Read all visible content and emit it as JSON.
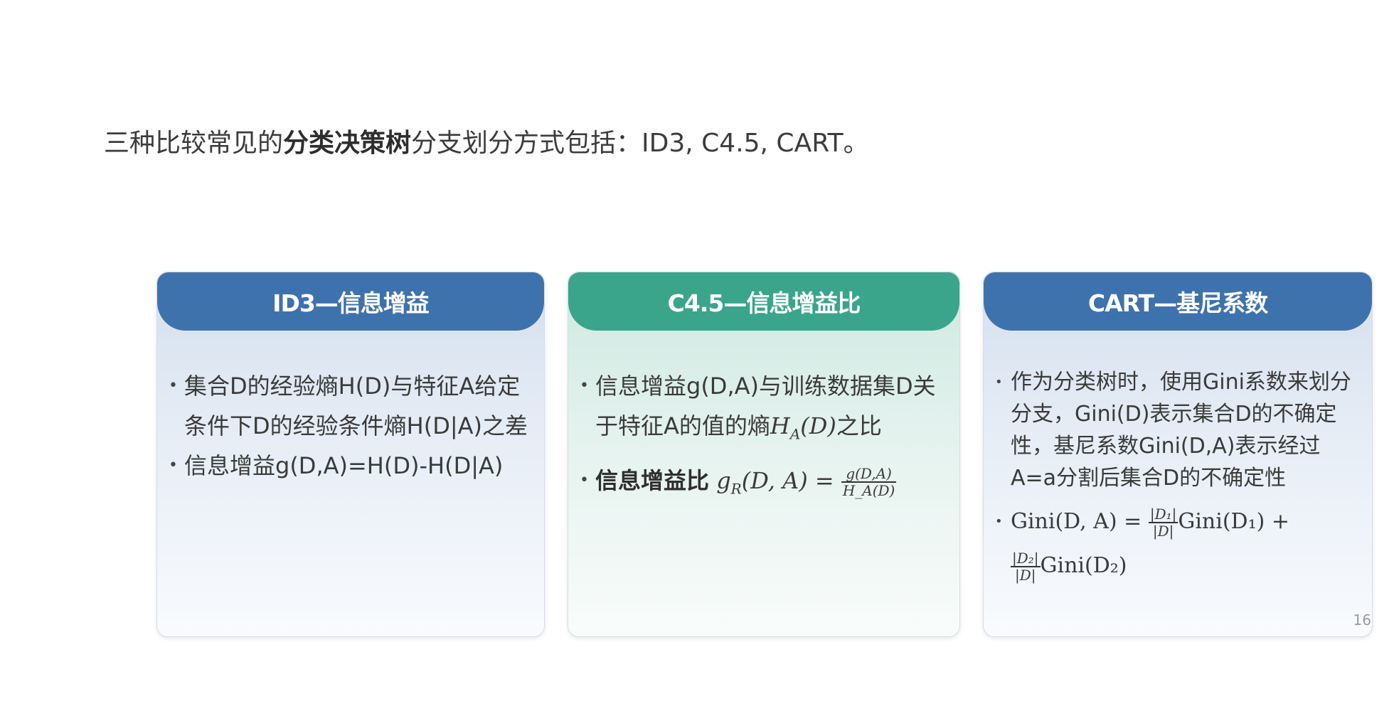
{
  "intro": {
    "prefix": "三种比较常见的",
    "bold": "分类决策树",
    "suffix": "分支划分方式包括：ID3, C4.5, CART。"
  },
  "cards": [
    {
      "title": "ID3—信息增益",
      "bullets": [
        "集合D的经验熵H(D)与特征A给定条件下D的经验条件熵H(D|A)之差",
        "信息增益g(D,A)=H(D)-H(D|A)"
      ]
    },
    {
      "title": "C4.5—信息增益比",
      "bullet1_text": "信息增益g(D,A)与训练数据集D关于特征A的值的熵",
      "bullet1_math": "H",
      "bullet1_math_sub": "A",
      "bullet1_math_tail": "(D)",
      "bullet1_end": "之比",
      "bullet2_label": "信息增益比",
      "bullet2_lhs": "g",
      "bullet2_lhs_sub": "R",
      "bullet2_lhs_tail": "(D, A) =",
      "bullet2_num": "g(D,A)",
      "bullet2_den": "H_A(D)"
    },
    {
      "title": "CART—基尼系数",
      "bullet1": "作为分类树时，使用Gini系数来划分分支，Gini(D)表示集合D的不确定性，基尼系数Gini(D,A)表示经过A=a分割后集合D的不确定性",
      "formula_lhs": "Gini(D, A) =",
      "frac1_num": "|D₁|",
      "frac1_den": "|D|",
      "term1": "Gini(D₁) +",
      "frac2_num": "|D₂|",
      "frac2_den": "|D|",
      "term2": "Gini(D₂)"
    }
  ],
  "page_number": "16",
  "colors": {
    "blue_header": "#3e72ad",
    "green_header": "#3aa58b"
  }
}
